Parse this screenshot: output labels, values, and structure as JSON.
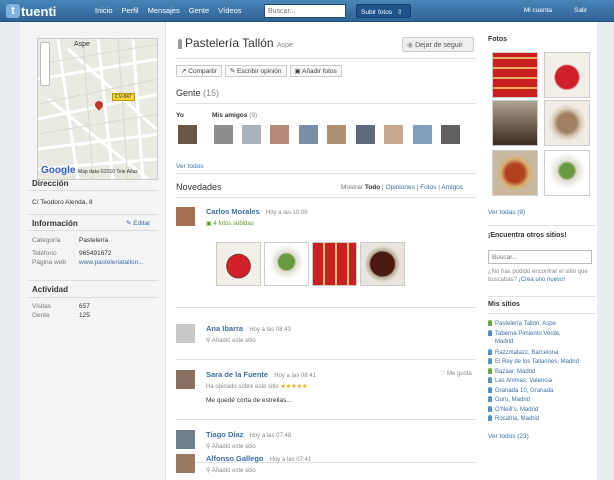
{
  "header": {
    "logo_text": "tuenti",
    "nav": [
      "Inicio",
      "Perfil",
      "Mensajes",
      "Gente",
      "Vídeos"
    ],
    "search_placeholder": "Buscar...",
    "upload_label": "Subir fotos",
    "account_label": "Mi cuenta",
    "logout_label": "Salir"
  },
  "map": {
    "place_label": "Aspe",
    "road_shield": "CV-847",
    "google_logo": "Google",
    "credit": "Map data ©2010 Tele Atlas"
  },
  "left": {
    "direccion_title": "Dirección",
    "address": "C/ Teodoro Alenda, 8",
    "info_title": "Información",
    "edit_label": "Editar",
    "info_rows": [
      {
        "key": "Categoría",
        "value": "Pastelería"
      },
      {
        "key": "Teléfono",
        "value": "965491672"
      },
      {
        "key": "Página web",
        "value": "www.pasteleriatallon..."
      }
    ],
    "activity_title": "Actividad",
    "activity_rows": [
      {
        "key": "Visitas",
        "value": "657"
      },
      {
        "key": "Gente",
        "value": "125"
      }
    ]
  },
  "place": {
    "name": "Pastelería Tallón",
    "city": "Aspe",
    "unfollow_label": "Dejar de seguir",
    "actions": [
      "Compartir",
      "Escribir opinión",
      "Añadir fotos"
    ]
  },
  "people": {
    "title": "Gente",
    "count": "(15)",
    "me_label": "Yo",
    "friends_label": "Mis amigos",
    "friends_count": "(9)",
    "see_all": "Ver todos"
  },
  "news": {
    "title": "Novedades",
    "show_label": "Mostrar",
    "filters": [
      "Todo",
      "Opiniones",
      "Fotos",
      "Amigos"
    ],
    "items": [
      {
        "name": "Carlos Morales",
        "time": "Hoy a las 10:08",
        "action": "4 fotos subidas"
      },
      {
        "name": "Ana Ibarra",
        "time": "Hoy a las 08:43",
        "action": "Añadió este sitio"
      },
      {
        "name": "Sara de la Fuente",
        "time": "Hoy a las 08:41",
        "action": "Ha opinado sobre este sitio",
        "stars": "★★★★★",
        "comment": "Me quedé corta de estrellas...",
        "like": "Me gusta"
      },
      {
        "name": "Tiago Díaz",
        "time": "Hoy a las 07:48",
        "action": "Añadió este sitio"
      },
      {
        "name": "Alfonso Gallego",
        "time": "Hoy a las 07:41",
        "action": "Añadió este sitio"
      }
    ]
  },
  "right": {
    "photos_title": "Fotos",
    "photos_see_all": "Ver todas (9)",
    "find_title": "¡Encuentra otros sitios!",
    "search_placeholder": "Buscar...",
    "note": "¿No has podido encontrar el sitio que buscabas?",
    "create_link": "¡Crea uno nuevo!",
    "my_sites_title": "Mis sitios",
    "sites": [
      "Pastelería Tallón, Aspe",
      "Taberna Pimiento Verde,",
      "Madrid",
      "Razzmatazz, Barcelona",
      "El Rey de los Tallarines, Madrid",
      "Bazaar, Madrid",
      "Las Animas, Valencia",
      "Granada 10, Granada",
      "Guru, Madrid",
      "O'Neill's, Madrid",
      "Rocafria, Madrid"
    ],
    "sites_see_all": "Ver todos (23)"
  },
  "colors": {
    "header": "#3a74a8",
    "link": "#3b6ea5",
    "pin_green": "#6aa84f",
    "pin_blue": "#5b8fc7"
  }
}
